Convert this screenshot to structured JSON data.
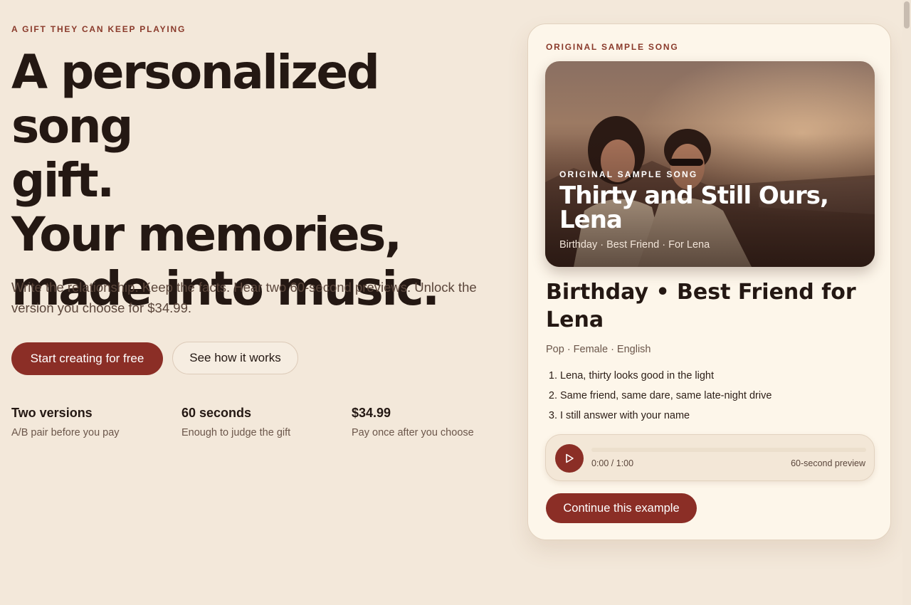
{
  "hero": {
    "eyebrow": "A GIFT THEY CAN KEEP PLAYING",
    "headline_lines": [
      "A personalized song",
      "gift.",
      "Your memories,",
      "made into music."
    ],
    "subtitle": "Write the relationship. Keep the facts. Hear two 60-second previews. Unlock the version you choose for $34.99.",
    "primary_cta": "Start creating for free",
    "secondary_cta": "See how it works"
  },
  "stats": [
    {
      "value": "Two versions",
      "label": "A/B pair before you pay"
    },
    {
      "value": "60 seconds",
      "label": "Enough to judge the gift"
    },
    {
      "value": "$34.99",
      "label": "Pay once after you choose"
    }
  ],
  "sample_card": {
    "eyebrow": "ORIGINAL SAMPLE SONG",
    "cover": {
      "eyebrow": "ORIGINAL SAMPLE SONG",
      "title": "Thirty and Still Ours, Lena",
      "meta": "Birthday · Best Friend · For Lena"
    },
    "song_title": "Birthday • Best Friend for Lena",
    "song_meta": "Pop · Female · English",
    "lyrics": [
      "Lena, thirty looks good in the light",
      "Same friend, same dare, same late-night drive",
      "I still answer with your name"
    ],
    "player": {
      "time": "0:00 / 1:00",
      "preview_label": "60-second preview",
      "progress": 0
    },
    "continue_cta": "Continue this example"
  },
  "colors": {
    "background": "#f3e8da",
    "accent": "#8b2e26",
    "eyebrow": "#8a3a2b",
    "text": "#241813"
  },
  "icons": {
    "play": "play-icon"
  }
}
